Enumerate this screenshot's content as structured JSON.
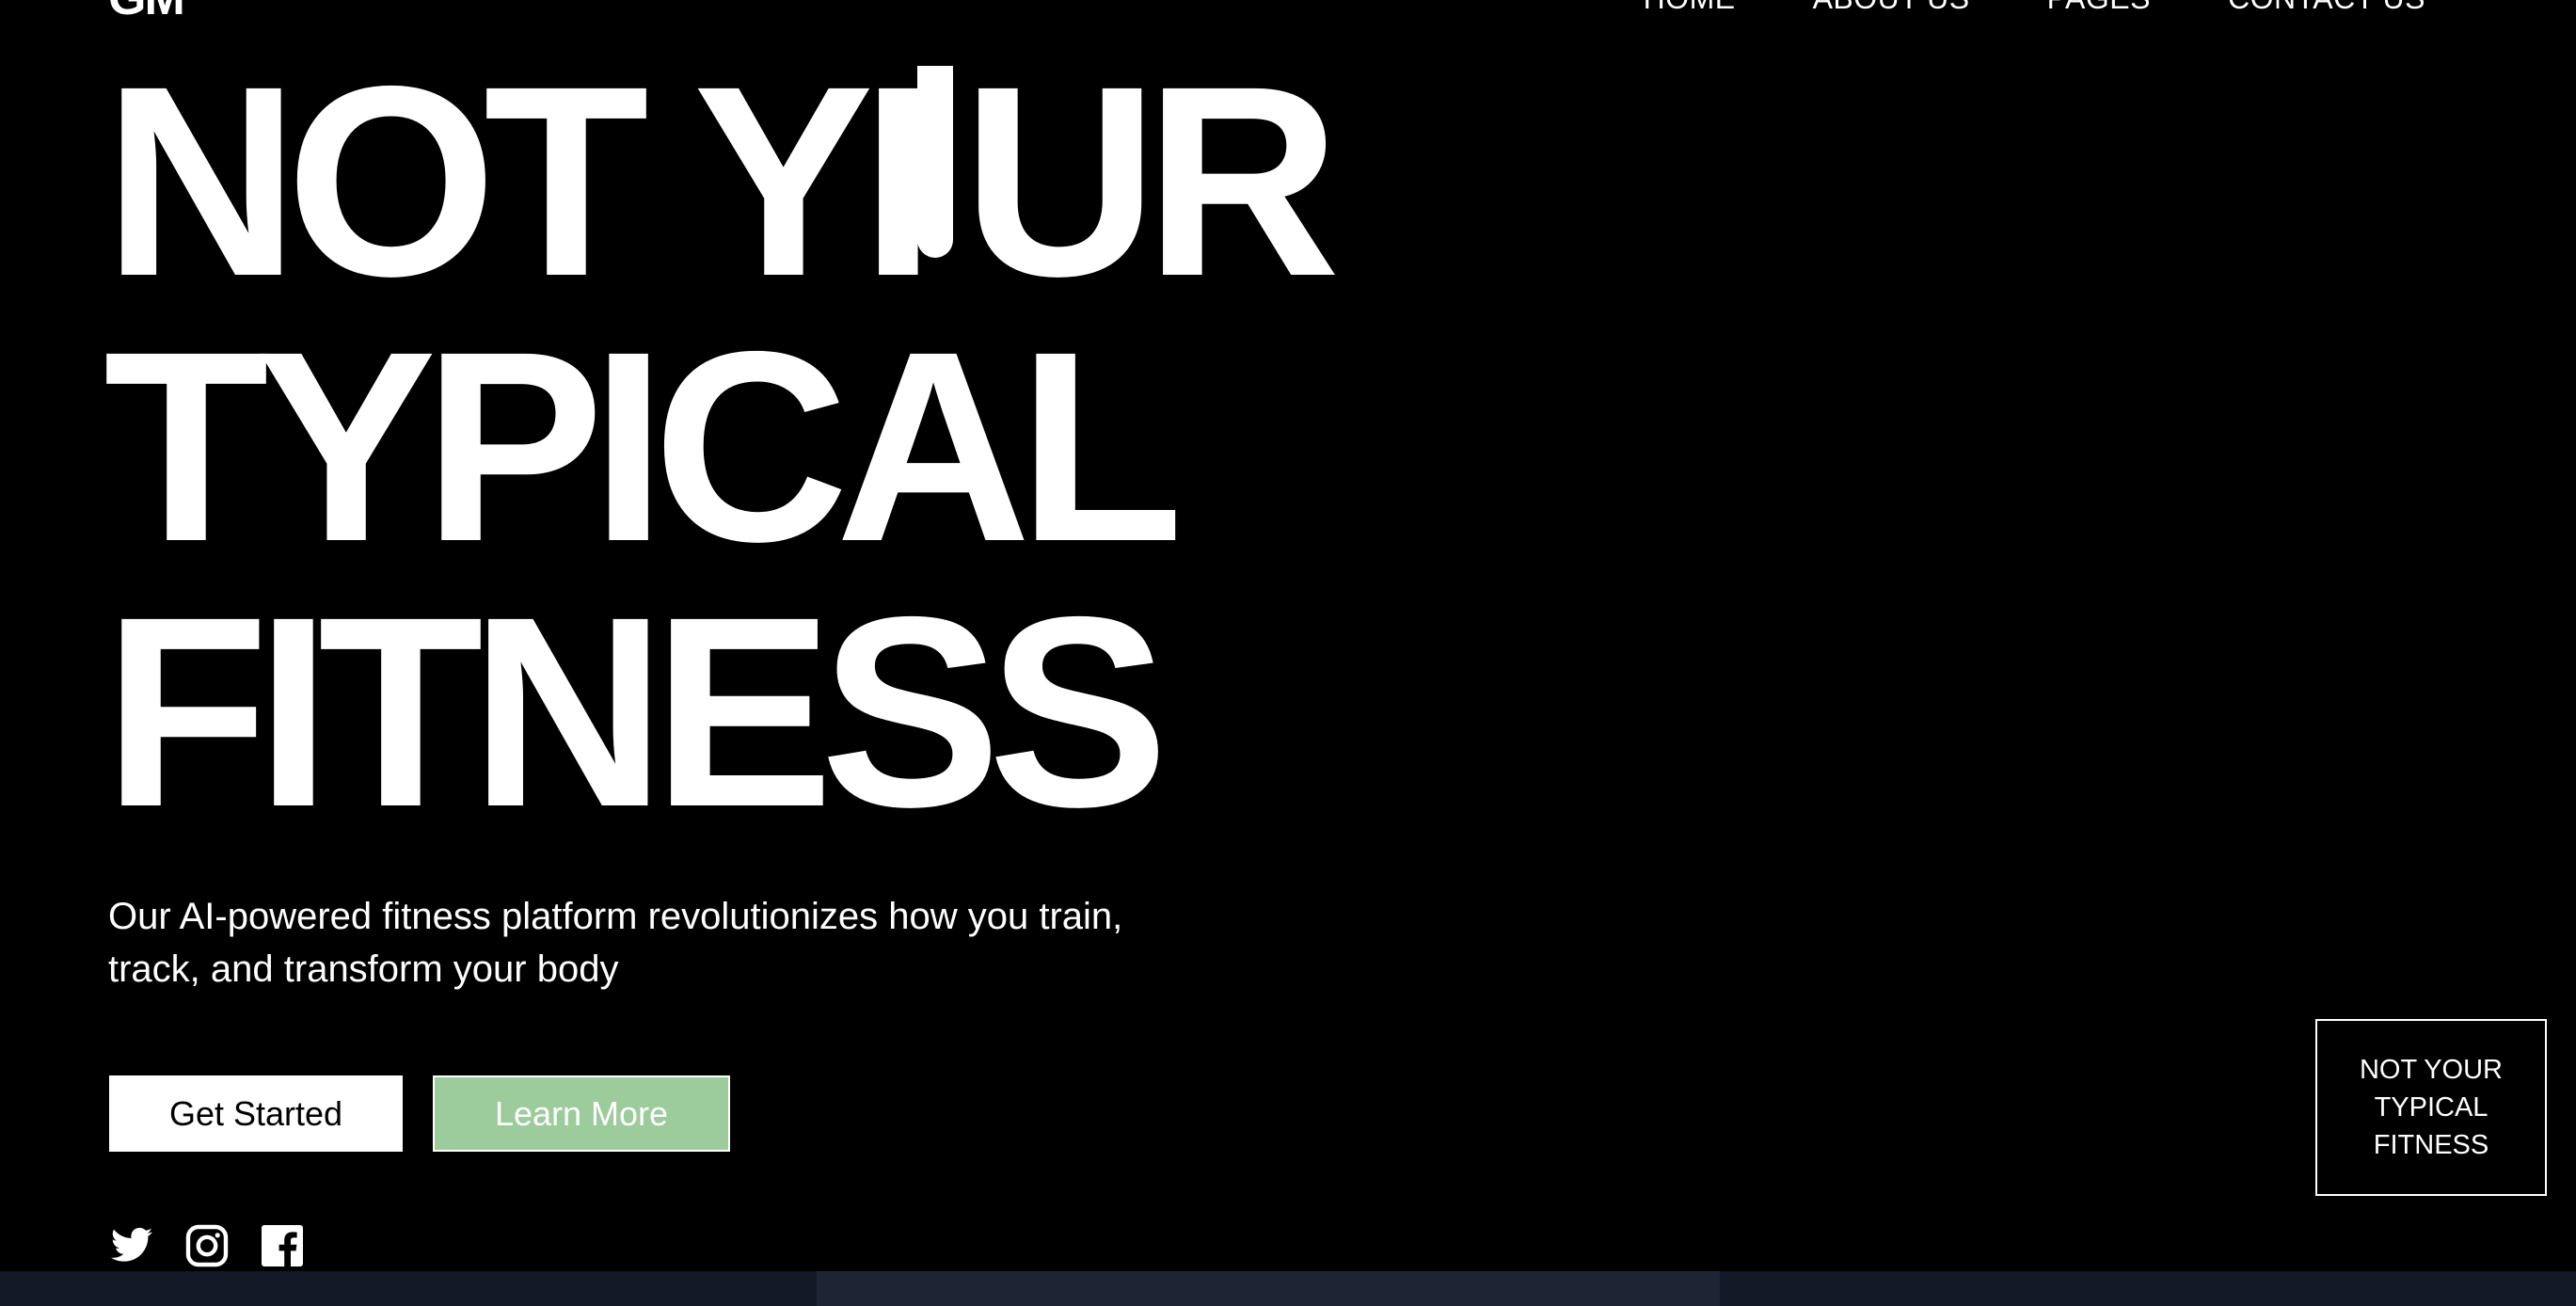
{
  "brand": {
    "logo": "GM"
  },
  "nav": {
    "items": [
      "HOME",
      "ABOUT US",
      "PAGES",
      "CONTACT US"
    ]
  },
  "hero": {
    "line1_before": "NOT YI",
    "line1_after": "UR",
    "line2": "TYPICAL",
    "line3": "FITNESS",
    "subtitle": "Our AI-powered fitness platform revolutionizes how you train, track, and transform your body"
  },
  "actions": {
    "primary_label": "Get Started",
    "secondary_label": "Learn More"
  },
  "social": {
    "icons": [
      "twitter-icon",
      "instagram-icon",
      "facebook-icon"
    ]
  },
  "badge": {
    "text": "NOT YOUR TYPICAL FITNESS"
  },
  "colors": {
    "background": "#000000",
    "text": "#ffffff",
    "accent_green": "#9ccb9c",
    "bottom_strip": "#121826"
  }
}
